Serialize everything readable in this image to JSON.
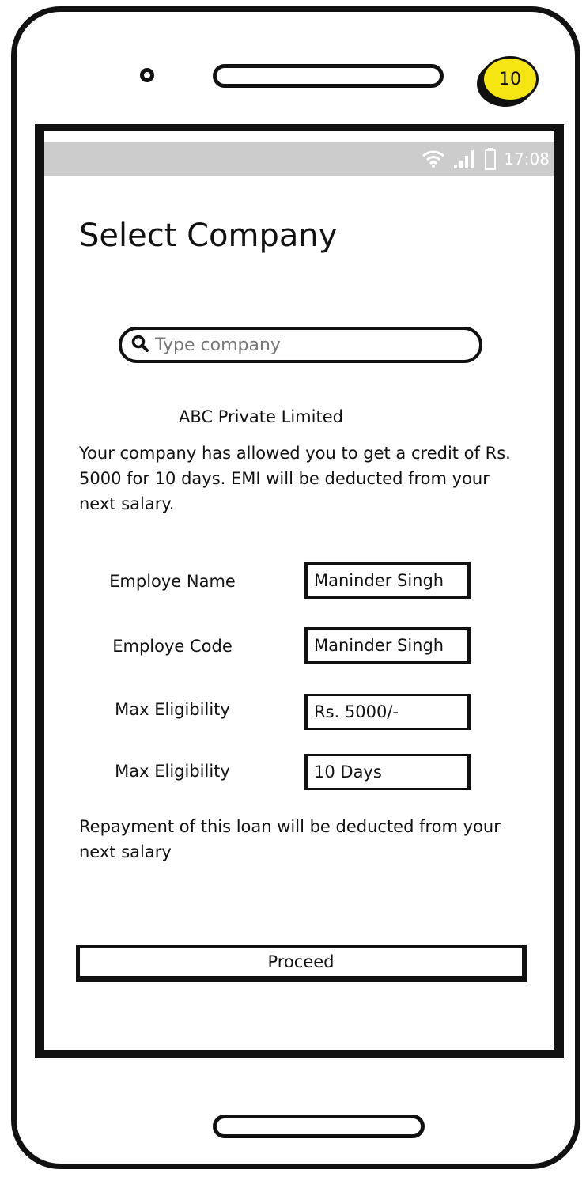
{
  "device": {
    "badge": "10"
  },
  "status_bar": {
    "time": "17:08",
    "icons": [
      "wifi-icon",
      "signal-icon",
      "battery-icon"
    ]
  },
  "page": {
    "title": "Select Company"
  },
  "search": {
    "placeholder": "Type company",
    "value": "",
    "icon": "search-icon"
  },
  "company": {
    "name": "ABC Private Limited",
    "info": "Your company has allowed you to get a credit of Rs. 5000 for 10 days. EMI will be deducted from your next salary."
  },
  "form": {
    "rows": [
      {
        "label": "Employe Name",
        "value": "Maninder Singh"
      },
      {
        "label": "Employe Code",
        "value": "Maninder Singh"
      },
      {
        "label": "Max Eligibility",
        "value": "Rs. 5000/-"
      },
      {
        "label": "Max Eligibility",
        "value": "10 Days"
      }
    ]
  },
  "repayment": {
    "text": "Repayment of this loan will be deducted from your next salary"
  },
  "actions": {
    "proceed_label": "Proceed"
  },
  "colors": {
    "badge": "#f5e513",
    "status_bar": "#cccccc",
    "outline": "#111111"
  }
}
